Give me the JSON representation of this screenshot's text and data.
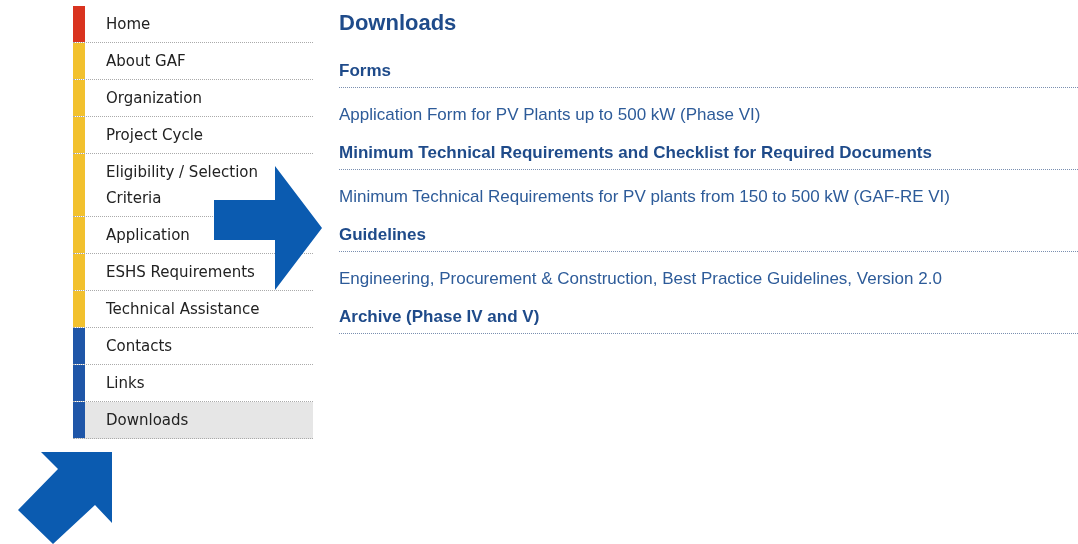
{
  "sidebar": {
    "items": [
      {
        "label": "Home",
        "color": "#d9331f",
        "selected": false
      },
      {
        "label": "About GAF",
        "color": "#f2c12e",
        "selected": false
      },
      {
        "label": "Organization",
        "color": "#f2c12e",
        "selected": false
      },
      {
        "label": "Project Cycle",
        "color": "#f2c12e",
        "selected": false
      },
      {
        "label": "Eligibility / Selection Criteria",
        "color": "#f2c12e",
        "selected": false
      },
      {
        "label": "Application",
        "color": "#f2c12e",
        "selected": false
      },
      {
        "label": "ESHS Requirements",
        "color": "#f2c12e",
        "selected": false
      },
      {
        "label": "Technical Assistance",
        "color": "#f2c12e",
        "selected": false
      },
      {
        "label": "Contacts",
        "color": "#1f56a8",
        "selected": false
      },
      {
        "label": "Links",
        "color": "#1f56a8",
        "selected": false
      },
      {
        "label": "Downloads",
        "color": "#1f56a8",
        "selected": true
      }
    ]
  },
  "content": {
    "title": "Downloads",
    "sections": [
      {
        "heading": "Forms",
        "links": [
          "Application Form for PV Plants up to 500 kW (Phase VI)"
        ]
      },
      {
        "heading": "Minimum Technical Requirements and Checklist for Required Documents",
        "links": [
          "Minimum Technical Requirements for PV plants from 150 to 500 kW (GAF-RE VI)"
        ]
      },
      {
        "heading": "Guidelines",
        "links": [
          "Engineering, Procurement & Construction, Best Practice Guidelines, Version 2.0"
        ]
      },
      {
        "heading": "Archive (Phase IV and V)"
      }
    ]
  }
}
